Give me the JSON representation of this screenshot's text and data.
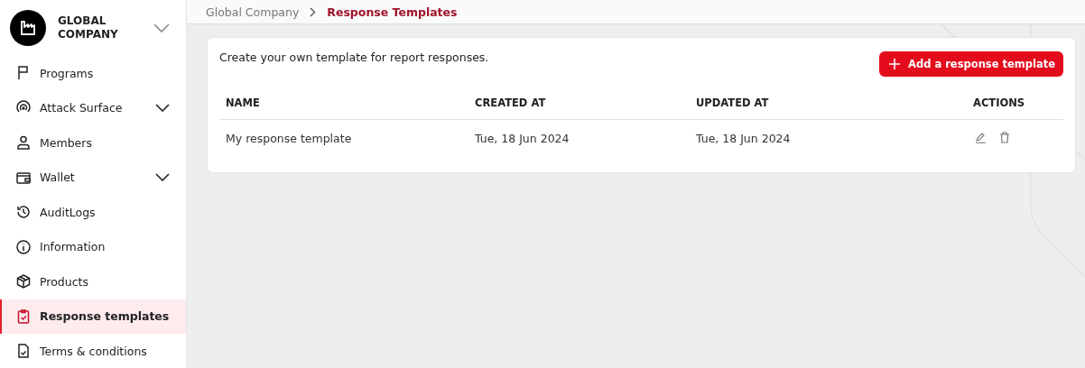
{
  "organization": {
    "name": "GLOBAL COMPANY"
  },
  "sidebar": {
    "items": [
      {
        "label": "Programs",
        "kind": "link",
        "selected": false
      },
      {
        "label": "Attack Surface",
        "kind": "group",
        "selected": false
      },
      {
        "label": "Members",
        "kind": "link",
        "selected": false
      },
      {
        "label": "Wallet",
        "kind": "group",
        "selected": false
      },
      {
        "label": "AuditLogs",
        "kind": "link",
        "selected": false
      },
      {
        "label": "Information",
        "kind": "link",
        "selected": false
      },
      {
        "label": "Products",
        "kind": "link",
        "selected": false
      },
      {
        "label": "Response templates",
        "kind": "link",
        "selected": true
      },
      {
        "label": "Terms & conditions",
        "kind": "link",
        "selected": false
      }
    ]
  },
  "breadcrumb": [
    {
      "label": "Global Company",
      "selected": false
    },
    {
      "label": "Response Templates",
      "selected": true
    }
  ],
  "card": {
    "description": "Create your own template for report responses.",
    "add_button": "Add a response template"
  },
  "table": {
    "columns": [
      "NAME",
      "CREATED AT",
      "UPDATED AT",
      "ACTIONS"
    ],
    "rows": [
      {
        "name": "My response template",
        "created_at": "Tue, 18 Jun 2024",
        "updated_at": "Tue, 18 Jun 2024"
      }
    ]
  }
}
